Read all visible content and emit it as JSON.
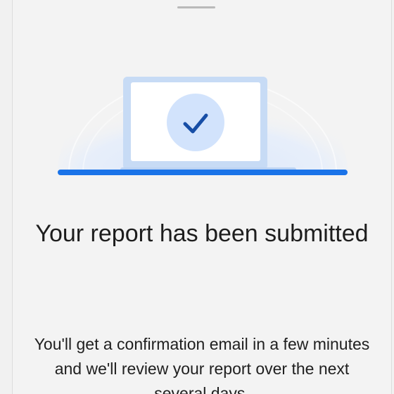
{
  "dialog": {
    "title": "Your report has been submitted",
    "message": "You'll get a confirmation email in a few minutes and we'll review your report over the next several days."
  },
  "illustration": {
    "icon": "checkmark-icon",
    "colors": {
      "accent": "#1a73e8",
      "laptop_frame": "#c7dbf5",
      "screen": "#ffffff",
      "check_circle": "#d2e3fc",
      "check": "#174ea6",
      "glow": "#e3ecfa"
    }
  },
  "colors": {
    "background": "#f3f3f3",
    "text": "#1d1d1d"
  }
}
